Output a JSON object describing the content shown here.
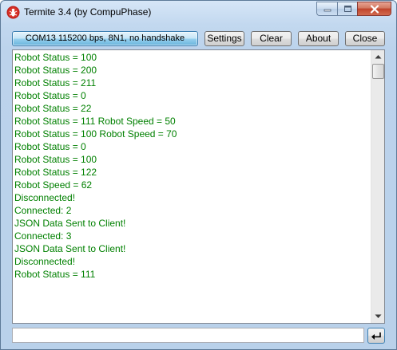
{
  "window": {
    "title": "Termite 3.4 (by CompuPhase)"
  },
  "toolbar": {
    "port_label": "COM13 115200 bps, 8N1, no handshake",
    "settings_label": "Settings",
    "clear_label": "Clear",
    "about_label": "About",
    "close_label": "Close"
  },
  "log": {
    "color": "#008000",
    "lines": [
      "Robot Status = 100",
      "Robot Status = 200",
      "Robot Status = 211",
      "Robot Status = 0",
      "Robot Status = 22",
      "Robot Status = 111 Robot Speed = 50",
      "Robot Status = 100 Robot Speed = 70",
      "Robot Status = 0",
      "Robot Status = 100",
      "Robot Status = 122",
      "Robot Speed = 62",
      "Disconnected!",
      "Connected: 2",
      "JSON Data Sent to Client!",
      "Connected: 3",
      "JSON Data Sent to Client!",
      "Disconnected!",
      "Robot Status = 111"
    ]
  },
  "input": {
    "value": ""
  },
  "icons": {
    "app": "termite-icon",
    "send": "enter-arrow-icon"
  }
}
